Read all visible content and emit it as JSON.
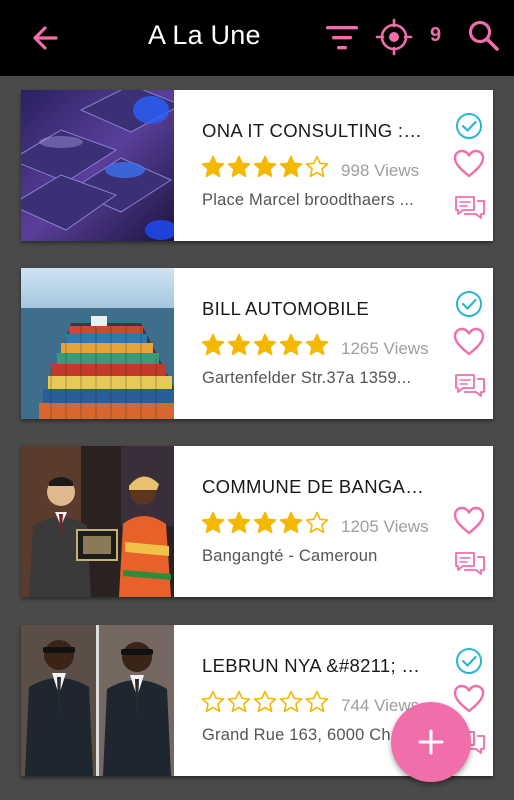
{
  "header": {
    "title": "A La Une",
    "badge_count": "9",
    "icons": [
      "back-arrow-icon",
      "filter-icon",
      "locate-icon",
      "search-icon"
    ]
  },
  "colors": {
    "accent": "#f06eaa",
    "check": "#29b6d4",
    "star": "#f5b800",
    "appbar": "#000000",
    "background": "#4a4a4a"
  },
  "listings": [
    {
      "name": "ONA IT CONSULTING : B...",
      "rating": 4,
      "max_rating": 5,
      "views": "998 Views",
      "address": "Place Marcel broodthaers ...",
      "verified": true,
      "image": "keyboard-photo"
    },
    {
      "name": "BILL AUTOMOBILE",
      "rating": 5,
      "max_rating": 5,
      "views": "1265 Views",
      "address": "Gartenfelder Str.37a 1359...",
      "verified": true,
      "image": "container-ship-photo"
    },
    {
      "name": "COMMUNE DE BANGAN...",
      "rating": 4,
      "max_rating": 5,
      "views": "1205 Views",
      "address": "Bangangté - Cameroun",
      "verified": false,
      "image": "award-ceremony-photo"
    },
    {
      "name": "LEBRUN NYA &#8211; C...",
      "rating": 0,
      "max_rating": 5,
      "views": "744 Views",
      "address": "Grand Rue 163, 6000 Ch...",
      "verified": true,
      "image": "two-men-in-suits-photo"
    }
  ],
  "fab": {
    "icon": "plus-icon"
  }
}
